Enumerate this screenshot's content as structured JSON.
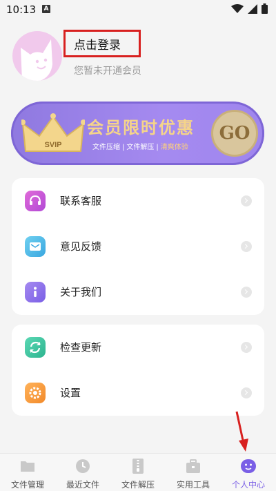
{
  "status_bar": {
    "time": "10:13",
    "notif_letter": "A"
  },
  "profile": {
    "login_label": "点击登录",
    "vip_status": "您暂未开通会员"
  },
  "banner": {
    "title": "会员限时优惠",
    "tag1": "文件压缩",
    "tag2": "文件解压",
    "tag3": "清爽体验",
    "crown_label": "SVIP",
    "go_label": "GO"
  },
  "menu_group_1": [
    {
      "label": "联系客服",
      "icon": "headset-icon",
      "color": "#c44fd8"
    },
    {
      "label": "意见反馈",
      "icon": "feedback-mail-icon",
      "color": "#3fb3e6"
    },
    {
      "label": "关于我们",
      "icon": "info-icon",
      "color": "#8a6bec"
    }
  ],
  "menu_group_2": [
    {
      "label": "检查更新",
      "icon": "refresh-icon",
      "color": "#34c3a0"
    },
    {
      "label": "设置",
      "icon": "gear-icon",
      "color": "#f59a3a"
    }
  ],
  "nav": [
    {
      "label": "文件管理",
      "icon": "folder-icon",
      "active": false
    },
    {
      "label": "最近文件",
      "icon": "clock-icon",
      "active": false
    },
    {
      "label": "文件解压",
      "icon": "zip-icon",
      "active": false
    },
    {
      "label": "实用工具",
      "icon": "toolbox-icon",
      "active": false
    },
    {
      "label": "个人中心",
      "icon": "profile-smile-icon",
      "active": true
    }
  ],
  "colors": {
    "accent": "#7a5fe6",
    "annotation_red": "#d8201f",
    "banner_bg": "#9f86ee"
  }
}
